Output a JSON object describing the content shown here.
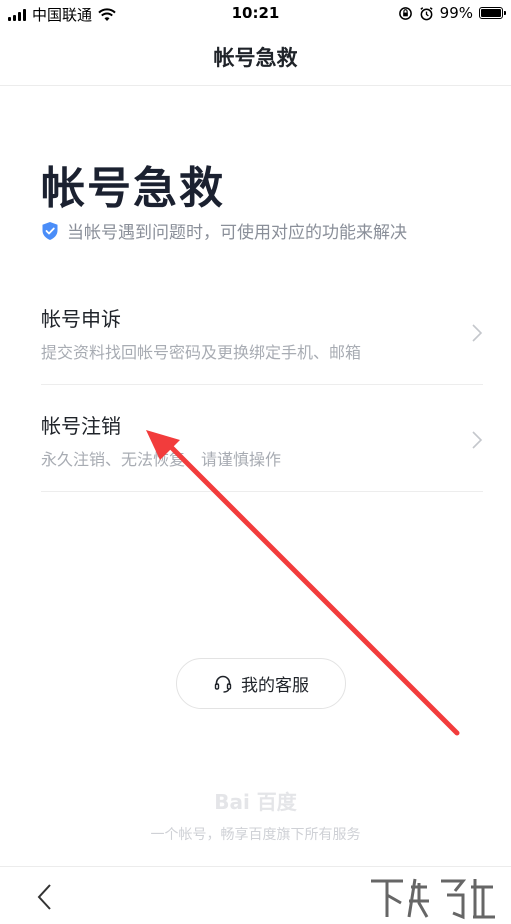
{
  "status_bar": {
    "carrier": "中国联通",
    "time": "10:21",
    "battery": "99%",
    "battery_level": 0.99
  },
  "nav": {
    "title": "帐号急救"
  },
  "header": {
    "title": "帐号急救",
    "subtitle": "当帐号遇到问题时，可使用对应的功能来解决"
  },
  "menu": {
    "items": [
      {
        "title": "帐号申诉",
        "description": "提交资料找回帐号密码及更换绑定手机、邮箱"
      },
      {
        "title": "帐号注销",
        "description": "永久注销、无法恢复、请谨慎操作"
      }
    ]
  },
  "support": {
    "label": "我的客服"
  },
  "footer": {
    "logo_text": "Bai 百度",
    "tagline": "一个帐号，畅享百度旗下所有服务"
  },
  "colors": {
    "accent_blue": "#4a8df8",
    "annotation_red": "#f23c3c"
  },
  "icons": {
    "shield": "shield-check-icon",
    "chevron": "chevron-right-icon",
    "headset": "headset-icon",
    "back": "back-arrow-icon"
  }
}
